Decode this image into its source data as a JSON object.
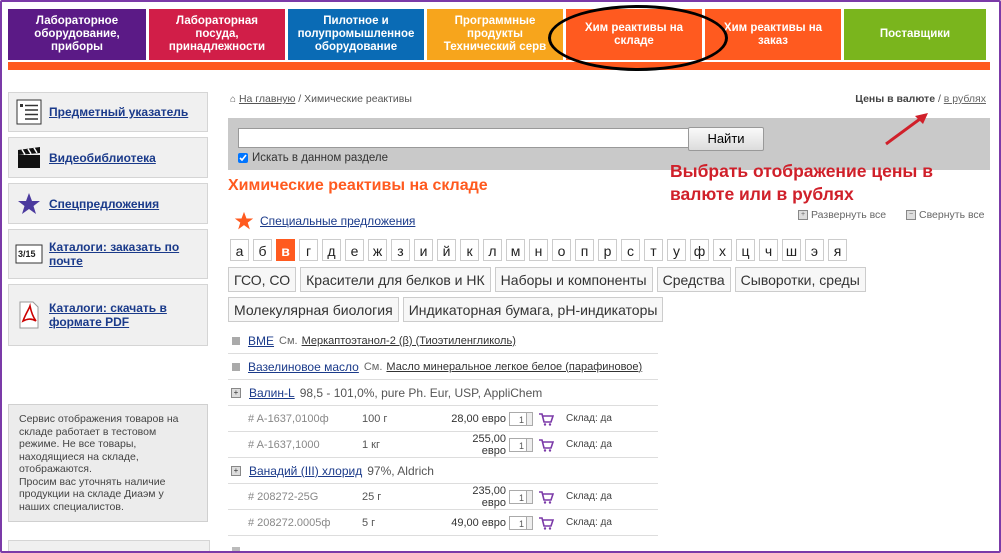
{
  "topnav": [
    {
      "label": "Лабораторное оборудование, приборы",
      "color": "#5b1a86"
    },
    {
      "label": "Лабораторная посуда, принадлежности",
      "color": "#d11e48"
    },
    {
      "label": "Пилотное и полупромышленное оборудование",
      "color": "#0a6bb5"
    },
    {
      "label": "Программные продукты Технический серв",
      "color": "#f7a51c"
    },
    {
      "label": "Хим реактивы на складе",
      "color": "#ff5a1f"
    },
    {
      "label": "Хим реактивы на заказ",
      "color": "#ff5a1f"
    },
    {
      "label": "Поставщики",
      "color": "#7ab51d"
    }
  ],
  "sidebar": [
    {
      "label": "Предметный указатель",
      "icon": "list-index-icon"
    },
    {
      "label": "Видеобиблиотека",
      "icon": "clapperboard-icon"
    },
    {
      "label": "Спецпредложения",
      "icon": "star-icon"
    },
    {
      "label": "Каталоги: заказать по почте",
      "icon": "catalog-icon"
    },
    {
      "label": "Каталоги: скачать в формате PDF",
      "icon": "pdf-icon"
    }
  ],
  "notice": "Сервис отображения товаров на складе работает в тестовом режиме. Не все товары, находящиеся на складе, отображаются.\nПросим вас уточнять наличие продукции на складе Диаэм у наших специалистов.",
  "breadcrumb": {
    "home": "На главную",
    "sep": " / ",
    "current": "Химические реактивы"
  },
  "currency": {
    "bold": "Цены в валюте",
    "sep": " / ",
    "link": "в рублях"
  },
  "search": {
    "value": "",
    "button": "Найти",
    "checkbox_label": "Искать в данном разделе"
  },
  "annotation": "Выбрать отображение цены в валюте или в рублях",
  "page_title": "Химические реактивы на складе",
  "special": "Специальные предложения",
  "expand_all": "Развернуть все",
  "collapse_all": "Свернуть все",
  "letters": [
    "а",
    "б",
    "в",
    "г",
    "д",
    "е",
    "ж",
    "з",
    "и",
    "й",
    "к",
    "л",
    "м",
    "н",
    "о",
    "п",
    "р",
    "с",
    "т",
    "у",
    "ф",
    "х",
    "ц",
    "ч",
    "ш",
    "э",
    "я"
  ],
  "active_letter": "в",
  "categories_row1": [
    "ГСО, СО",
    "Красители для белков и НК",
    "Наборы и компоненты",
    "Средства",
    "Сыворотки, среды"
  ],
  "categories_row2": [
    "Молекулярная биология",
    "Индикаторная бумага, pH-индикаторы"
  ],
  "items": {
    "i1": {
      "name": "BME",
      "see": "См.",
      "ref": "Меркаптоэтанол-2 (β) (Тиоэтиленгликоль)"
    },
    "i2": {
      "name": "Вазелиновое масло",
      "see": "См.",
      "ref": "Масло минеральное легкое белое (парафиновое)"
    },
    "i3": {
      "name": "Валин-L",
      "desc": "98,5 - 101,0%, pure Ph. Eur, USP, AppliChem",
      "rows": [
        {
          "art": "# A-1637,0100ф",
          "qty": "100 г",
          "price": "28,00 евро",
          "count": "1",
          "stock": "Склад: да"
        },
        {
          "art": "# A-1637,1000",
          "qty": "1 кг",
          "price": "255,00 евро",
          "count": "1",
          "stock": "Склад: да"
        }
      ]
    },
    "i4": {
      "name": "Ванадий (III) хлорид",
      "desc": "97%, Aldrich",
      "rows": [
        {
          "art": "# 208272-25G",
          "qty": "25 г",
          "price": "235,00 евро",
          "count": "1",
          "stock": "Склад: да"
        },
        {
          "art": "# 208272.0005ф",
          "qty": "5 г",
          "price": "49,00 евро",
          "count": "1",
          "stock": "Склад: да"
        }
      ]
    }
  }
}
